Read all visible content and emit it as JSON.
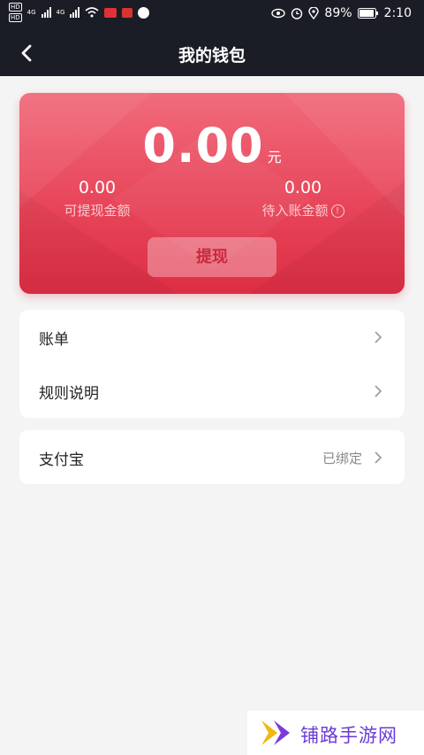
{
  "status_bar": {
    "left_hd1": "HD",
    "left_hd2": "HD",
    "net1": "4G",
    "net2": "4G",
    "battery": "89%",
    "time": "2:10"
  },
  "nav": {
    "title": "我的钱包",
    "back_icon": "chevron-left-icon"
  },
  "wallet": {
    "amount": "0.00",
    "unit": "元",
    "withdrawable_value": "0.00",
    "withdrawable_label": "可提现金额",
    "pending_value": "0.00",
    "pending_label": "待入账金额",
    "withdraw_button": "提现",
    "card_colors": [
      "#f06b7c",
      "#dd2d44"
    ]
  },
  "list1": [
    {
      "label": "账单"
    },
    {
      "label": "规则说明"
    }
  ],
  "list2": [
    {
      "label": "支付宝",
      "value": "已绑定"
    }
  ],
  "watermark": {
    "text": "铺路手游网",
    "color": "#6a3ad6"
  }
}
